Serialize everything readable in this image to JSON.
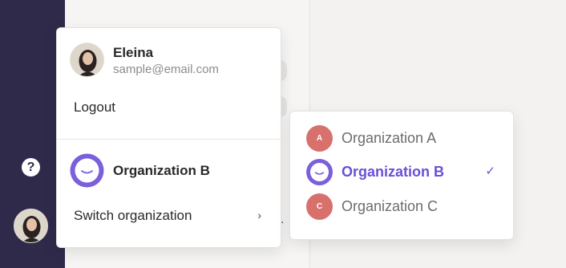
{
  "sidebar": {
    "help_glyph": "?"
  },
  "account_menu": {
    "user_name": "Eleina",
    "user_email": "sample@email.com",
    "logout_label": "Logout",
    "current_org_name": "Organization B",
    "switch_org_label": "Switch organization",
    "switch_chevron": "›"
  },
  "org_menu": {
    "items": [
      {
        "initial": "A",
        "label": "Organization A",
        "selected": false
      },
      {
        "initial": "",
        "label": "Organization B",
        "selected": true,
        "check": "✓"
      },
      {
        "initial": "C",
        "label": "Organization C",
        "selected": false
      }
    ]
  },
  "colors": {
    "accent": "#6a4fd6",
    "org_badge": "#d8706c",
    "sidebar": "#2f2a4a"
  }
}
